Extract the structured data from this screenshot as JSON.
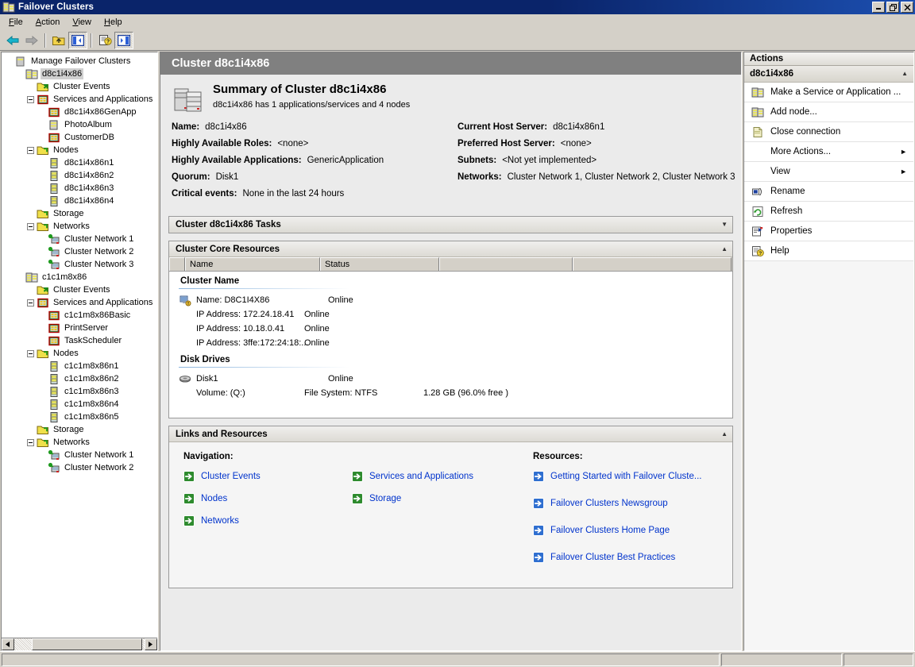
{
  "window": {
    "title": "Failover Clusters",
    "icon": "cluster-icon",
    "minimize_label": "_",
    "restore_label": "❐",
    "close_label": "✕"
  },
  "menu": {
    "items": [
      {
        "label": "File",
        "accel": "F"
      },
      {
        "label": "Action",
        "accel": "A"
      },
      {
        "label": "View",
        "accel": "V"
      },
      {
        "label": "Help",
        "accel": "H"
      }
    ]
  },
  "toolbar": {
    "buttons": [
      {
        "name": "back-icon",
        "tooltip": "Back",
        "state": "enabled"
      },
      {
        "name": "forward-icon",
        "tooltip": "Forward",
        "state": "disabled"
      },
      {
        "name": "up-one-level-icon",
        "tooltip": "Up One Level",
        "state": "enabled"
      },
      {
        "name": "show-hide-tree-icon",
        "tooltip": "Show/Hide Console Tree",
        "state": "pressed"
      },
      {
        "name": "help-icon",
        "tooltip": "Help",
        "state": "enabled"
      },
      {
        "name": "show-hide-action-pane-icon",
        "tooltip": "Show/Hide Action Pane",
        "state": "pressed"
      }
    ]
  },
  "tree": {
    "root": "Manage Failover Clusters",
    "selected": "d8c1i4x86",
    "nodes": [
      {
        "label": "Manage Failover Clusters",
        "depth": 0,
        "icon": "console-root-icon",
        "expander": "none"
      },
      {
        "label": "d8c1i4x86",
        "depth": 1,
        "icon": "cluster-icon",
        "expander": "none",
        "selected": true
      },
      {
        "label": "Cluster Events",
        "depth": 2,
        "icon": "events-folder-icon",
        "expander": "none"
      },
      {
        "label": "Services and Applications",
        "depth": 2,
        "icon": "services-apps-icon",
        "expander": "minus"
      },
      {
        "label": "d8c1i4x86GenApp",
        "depth": 3,
        "icon": "application-icon",
        "expander": "none"
      },
      {
        "label": "PhotoAlbum",
        "depth": 3,
        "icon": "service-icon",
        "expander": "none"
      },
      {
        "label": "CustomerDB",
        "depth": 3,
        "icon": "application-icon",
        "expander": "none"
      },
      {
        "label": "Nodes",
        "depth": 2,
        "icon": "folder-icon",
        "expander": "minus"
      },
      {
        "label": "d8c1i4x86n1",
        "depth": 3,
        "icon": "node-icon",
        "expander": "none"
      },
      {
        "label": "d8c1i4x86n2",
        "depth": 3,
        "icon": "node-icon",
        "expander": "none"
      },
      {
        "label": "d8c1i4x86n3",
        "depth": 3,
        "icon": "node-icon",
        "expander": "none"
      },
      {
        "label": "d8c1i4x86n4",
        "depth": 3,
        "icon": "node-icon",
        "expander": "none"
      },
      {
        "label": "Storage",
        "depth": 2,
        "icon": "folder-icon",
        "expander": "none"
      },
      {
        "label": "Networks",
        "depth": 2,
        "icon": "folder-icon",
        "expander": "minus"
      },
      {
        "label": "Cluster Network 1",
        "depth": 3,
        "icon": "network-icon",
        "expander": "none"
      },
      {
        "label": "Cluster Network 2",
        "depth": 3,
        "icon": "network-icon",
        "expander": "none"
      },
      {
        "label": "Cluster Network 3",
        "depth": 3,
        "icon": "network-icon",
        "expander": "none"
      },
      {
        "label": "c1c1m8x86",
        "depth": 1,
        "icon": "cluster-icon",
        "expander": "none"
      },
      {
        "label": "Cluster Events",
        "depth": 2,
        "icon": "events-folder-icon",
        "expander": "none"
      },
      {
        "label": "Services and Applications",
        "depth": 2,
        "icon": "services-apps-icon",
        "expander": "minus"
      },
      {
        "label": "c1c1m8x86Basic",
        "depth": 3,
        "icon": "application-icon",
        "expander": "none"
      },
      {
        "label": "PrintServer",
        "depth": 3,
        "icon": "application-icon",
        "expander": "none"
      },
      {
        "label": "TaskScheduler",
        "depth": 3,
        "icon": "application-icon",
        "expander": "none"
      },
      {
        "label": "Nodes",
        "depth": 2,
        "icon": "folder-icon",
        "expander": "minus"
      },
      {
        "label": "c1c1m8x86n1",
        "depth": 3,
        "icon": "node-icon",
        "expander": "none"
      },
      {
        "label": "c1c1m8x86n2",
        "depth": 3,
        "icon": "node-icon",
        "expander": "none"
      },
      {
        "label": "c1c1m8x86n3",
        "depth": 3,
        "icon": "node-icon",
        "expander": "none"
      },
      {
        "label": "c1c1m8x86n4",
        "depth": 3,
        "icon": "node-icon",
        "expander": "none"
      },
      {
        "label": "c1c1m8x86n5",
        "depth": 3,
        "icon": "node-icon",
        "expander": "none"
      },
      {
        "label": "Storage",
        "depth": 2,
        "icon": "folder-icon",
        "expander": "none"
      },
      {
        "label": "Networks",
        "depth": 2,
        "icon": "folder-icon",
        "expander": "minus"
      },
      {
        "label": "Cluster Network 1",
        "depth": 3,
        "icon": "network-icon",
        "expander": "none"
      },
      {
        "label": "Cluster Network 2",
        "depth": 3,
        "icon": "network-icon",
        "expander": "none"
      }
    ]
  },
  "content": {
    "header": "Cluster d8c1i4x86",
    "summary_title": "Summary of Cluster d8c1i4x86",
    "summary_sub": "d8c1i4x86 has 1 applications/services and 4 nodes",
    "properties_left": [
      {
        "label": "Name:",
        "value": "d8c1i4x86"
      },
      {
        "label": "Highly Available Roles:",
        "value": "<none>"
      },
      {
        "label": "Highly Available Applications:",
        "value": "GenericApplication"
      },
      {
        "label": "Quorum:",
        "value": "Disk1"
      },
      {
        "label": "Critical events:",
        "value": "None in the last 24 hours"
      }
    ],
    "properties_right": [
      {
        "label": "Current Host Server:",
        "value": "d8c1i4x86n1"
      },
      {
        "label": "Preferred Host Server:",
        "value": "<none>"
      },
      {
        "label": "Subnets:",
        "value": "<Not yet implemented>"
      },
      {
        "label": "Networks:",
        "value": "Cluster Network 1, Cluster Network 2, Cluster Network 3"
      }
    ],
    "tasks_panel": {
      "title": "Cluster d8c1i4x86 Tasks",
      "collapsed": true,
      "chevron": "▼"
    },
    "core_resources": {
      "title": "Cluster Core Resources",
      "collapsed": false,
      "chevron": "▲",
      "columns": [
        "",
        "Name",
        "Status",
        "",
        ""
      ],
      "groups": [
        {
          "title": "Cluster Name",
          "rows": [
            {
              "icon": "cluster-name-resource-icon",
              "name": "Name: D8C1I4X86",
              "status": "Online",
              "extra": "",
              "indent": false
            },
            {
              "icon": "",
              "name": "IP Address: 172.24.18.41",
              "status": "Online",
              "extra": "",
              "indent": true
            },
            {
              "icon": "",
              "name": "IP Address: 10.18.0.41",
              "status": "Online",
              "extra": "",
              "indent": true
            },
            {
              "icon": "",
              "name": "IP Address: 3ffe:172:24:18:...",
              "status": "Online",
              "extra": "",
              "indent": true
            }
          ]
        },
        {
          "title": "Disk Drives",
          "rows": [
            {
              "icon": "disk-icon",
              "name": "Disk1",
              "status": "Online",
              "extra": "",
              "indent": false
            },
            {
              "icon": "",
              "name": "Volume: (Q:)",
              "status": "File System: NTFS",
              "extra": "1.28 GB (96.0% free )",
              "indent": true
            }
          ]
        }
      ]
    },
    "links_panel": {
      "title": "Links and Resources",
      "collapsed": false,
      "chevron": "▲",
      "navigation_heading": "Navigation:",
      "navigation_col1": [
        "Cluster Events",
        "Nodes",
        "Networks"
      ],
      "navigation_col2": [
        "Services and Applications",
        "Storage"
      ],
      "resources_heading": "Resources:",
      "resources": [
        "Getting  Started  with  Failover Cluste...",
        "Failover Clusters Newsgroup",
        "Failover Clusters Home Page",
        "Failover Cluster Best Practices"
      ]
    }
  },
  "actions": {
    "title": "Actions",
    "group": "d8c1i4x86",
    "group_chevron": "▲",
    "items": [
      {
        "label": "Make a Service or Application ...",
        "icon": "cluster-icon",
        "submenu": ""
      },
      {
        "label": "Add node...",
        "icon": "cluster-icon",
        "submenu": ""
      },
      {
        "label": "Close connection",
        "icon": "page-icon",
        "submenu": ""
      },
      {
        "label": "More Actions...",
        "icon": "",
        "submenu": "►"
      },
      {
        "label": "View",
        "icon": "",
        "submenu": "►"
      },
      {
        "label": "Rename",
        "icon": "rename-icon",
        "submenu": ""
      },
      {
        "label": "Refresh",
        "icon": "refresh-icon",
        "submenu": ""
      },
      {
        "label": "Properties",
        "icon": "properties-icon",
        "submenu": ""
      },
      {
        "label": "Help",
        "icon": "help-icon",
        "submenu": ""
      }
    ]
  },
  "statusbar": {
    "pane1": "",
    "pane2": "",
    "pane3": ""
  },
  "colors": {
    "titlebar": "#0a246a",
    "window_face": "#d4d0c8",
    "content_header": "#808080",
    "link": "#0033cc",
    "nav_arrow": "#2e8b2e",
    "res_arrow": "#2f6fd0"
  }
}
